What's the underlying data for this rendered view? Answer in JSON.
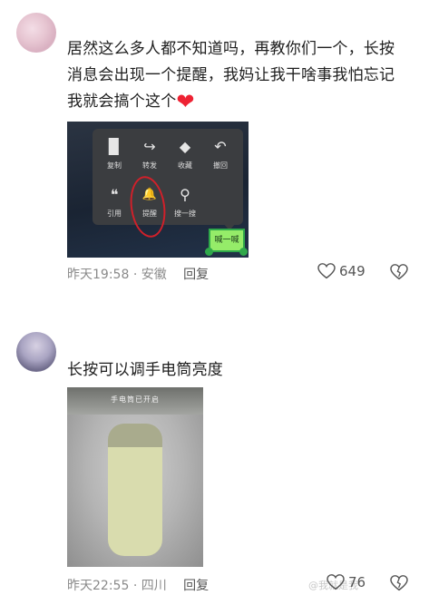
{
  "comment1": {
    "text_line1": "居然这么多人都不知道吗，再教你们一个，长按",
    "text_line2": "消息会出现一个提醒，我妈让我干啥事我怕忘记",
    "text_line3": "我就会搞个这个",
    "emoji": "❤",
    "menu": [
      {
        "icon": "copy-icon",
        "glyph": "▉",
        "label": "复制"
      },
      {
        "icon": "forward-icon",
        "glyph": "↪",
        "label": "转发"
      },
      {
        "icon": "favorite-icon",
        "glyph": "◆",
        "label": "收藏"
      },
      {
        "icon": "undo-icon",
        "glyph": "↶",
        "label": "撤回"
      },
      {
        "icon": "quote-icon",
        "glyph": "❝",
        "label": "引用"
      },
      {
        "icon": "reminder-bell-icon",
        "glyph": "🔔",
        "label": "提醒"
      },
      {
        "icon": "search-icon",
        "glyph": "⚲",
        "label": "搜一搜"
      }
    ],
    "bubble_text": "喊一喊",
    "time": "昨天19:58",
    "location": "安徽",
    "reply": "回复",
    "likes": "649"
  },
  "comment2": {
    "text": "长按可以调手电筒亮度",
    "screen_text": "手电筒已开启",
    "brightness_level": 0.82,
    "time": "昨天22:55",
    "location": "四川",
    "reply": "回复",
    "likes": "76",
    "watermark": "@我就是我"
  },
  "colors": {
    "annotation_red": "#d0202a",
    "slider_fill": "#d9dcae",
    "bubble_green": "#95ec69"
  }
}
